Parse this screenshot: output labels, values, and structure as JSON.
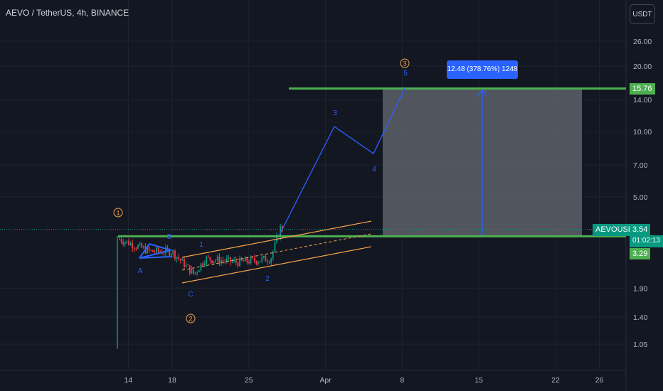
{
  "header": {
    "title": "AEVO / TetherUS, 4h, BINANCE",
    "currency_button": "USDT"
  },
  "colors": {
    "background": "#131722",
    "grid": "#1f2330",
    "axis_text": "#b2b5be",
    "up": "#089981",
    "down": "#f23645",
    "green_level": "#4caf50",
    "channel": "#f7a24a",
    "wave_blue": "#2962ff",
    "wave_orange": "#f7a24a",
    "projection_box": "#5d6068"
  },
  "price_tags": {
    "target": "15.76",
    "last": "3.54",
    "countdown": "01:02:13",
    "support": "3.29",
    "symbol": "AEVOUSDT"
  },
  "measure_label": "12.48 (378.76%) 1248",
  "chart_data": {
    "type": "candlestick",
    "symbol": "AEVO / TetherUS",
    "interval": "4h",
    "exchange": "BINANCE",
    "y_scale": "log",
    "ylim": [
      0.93,
      35
    ],
    "y_ticks": [
      "26.00",
      "20.00",
      "14.00",
      "10.00",
      "7.00",
      "5.00",
      "1.90",
      "1.40",
      "1.05"
    ],
    "x_ticks": [
      "14",
      "18",
      "25",
      "Apr",
      "8",
      "15",
      "22",
      "26"
    ],
    "horizontal_levels": [
      15.76,
      3.29
    ],
    "last_price": 3.54,
    "price_path_approx": [
      {
        "date": "Mar 13",
        "price": 1.0
      },
      {
        "date": "Mar 13",
        "price": 3.2
      },
      {
        "date": "Mar 16",
        "price": 2.8
      },
      {
        "date": "Mar 18",
        "price": 2.8
      },
      {
        "date": "Mar 20",
        "price": 2.2
      },
      {
        "date": "Mar 21",
        "price": 2.6
      },
      {
        "date": "Mar 24",
        "price": 2.5
      },
      {
        "date": "Mar 27",
        "price": 2.6
      },
      {
        "date": "Mar 28",
        "price": 3.6
      },
      {
        "date": "Mar 28",
        "price": 3.54
      }
    ],
    "projection_path": [
      {
        "date": "Mar 28",
        "price": 3.5
      },
      {
        "date": "Apr 1",
        "price": 10.5
      },
      {
        "date": "Apr 5",
        "price": 8.0
      },
      {
        "date": "Apr 8",
        "price": 15.76
      }
    ],
    "wave_labels_blue": [
      "A",
      "B",
      "C",
      "1",
      "2",
      "3",
      "4",
      "5"
    ],
    "wave_labels_orange": [
      "1",
      "2",
      "3"
    ],
    "measure": {
      "change": "12.48",
      "percent": "378.76%",
      "ticks": "1248"
    }
  }
}
